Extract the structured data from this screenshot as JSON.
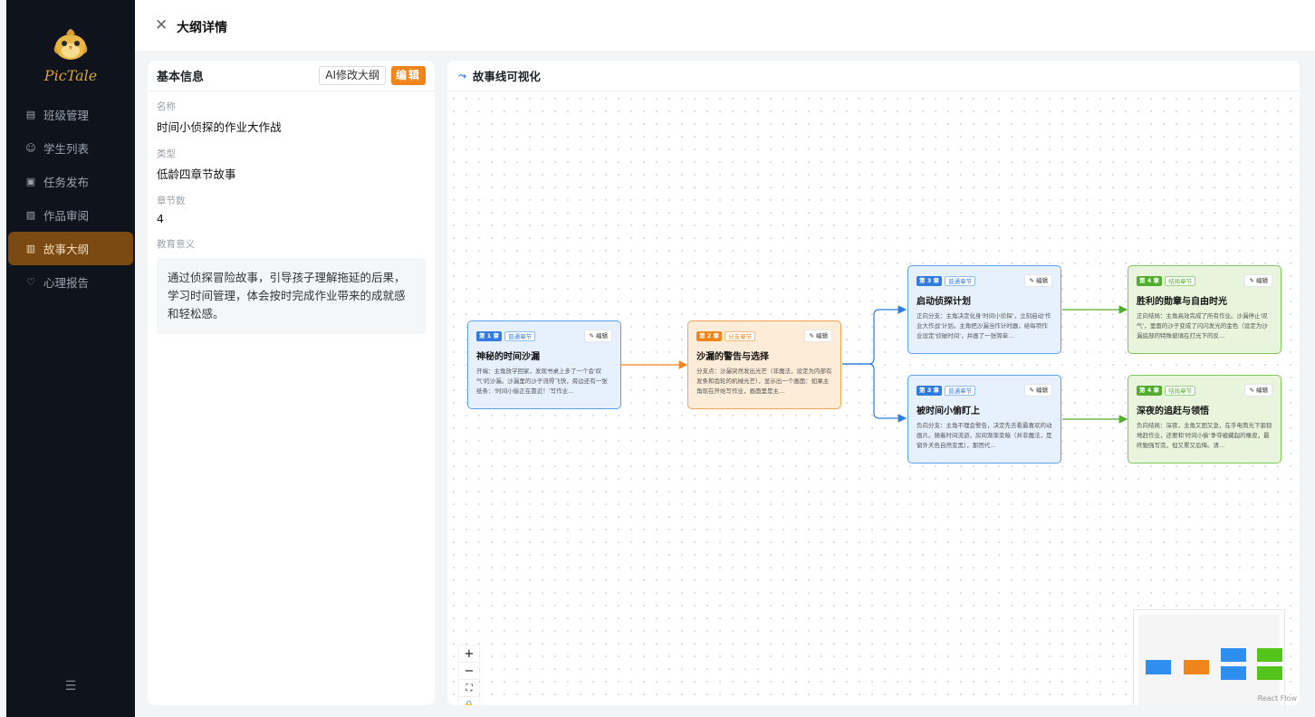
{
  "app": {
    "logo_text": "PicTale"
  },
  "sidebar": {
    "items": [
      {
        "label": "班级管理",
        "icon": "class-icon"
      },
      {
        "label": "学生列表",
        "icon": "student-icon"
      },
      {
        "label": "任务发布",
        "icon": "task-icon"
      },
      {
        "label": "作品审阅",
        "icon": "review-icon"
      },
      {
        "label": "故事大纲",
        "icon": "outline-icon",
        "active": true
      },
      {
        "label": "心理报告",
        "icon": "heart-icon"
      }
    ]
  },
  "header": {
    "title": "大纲详情"
  },
  "info": {
    "title": "基本信息",
    "ai_button": "AI修改大纲",
    "edit_button": "编辑",
    "name_label": "名称",
    "name_value": "时间小侦探的作业大作战",
    "type_label": "类型",
    "type_value": "低龄四章节故事",
    "chapters_label": "章节数",
    "chapters_value": "4",
    "edu_label": "教育意义",
    "edu_value": "通过侦探冒险故事，引导孩子理解拖延的后果，学习时间管理，体会按时完成作业带来的成就感和轻松感。"
  },
  "flow": {
    "title": "故事线可视化",
    "watermark": "React Flow",
    "edit_label": "编辑",
    "nodes": [
      {
        "chapter": "第 1 章",
        "type": "普通章节",
        "title": "神秘的时间沙漏",
        "desc": "开端：主角放学回家，发现书桌上多了一个会'叹气'的沙漏。沙漏里的沙子流得飞快，旁边还有一张纸条：'时间小偷正在靠近！'写作业...",
        "color": "blue"
      },
      {
        "chapter": "第 2 章",
        "type": "分支章节",
        "title": "沙漏的警告与选择",
        "desc": "分支点：沙漏突然发出光芒（非魔法，设定为内部有发条和齿轮的机械光芒），显示出一个画面：如果主角现在开始写作业，画面里是主...",
        "color": "orange"
      },
      {
        "chapter": "第 3 章",
        "type": "普通章节",
        "title": "启动侦探计划",
        "desc": "正向分支：主角决定化身'时间小侦探'，立刻启动'作业大作战'计划。主角把沙漏当作计时器，给每项作业设定'侦破时间'，并画了一张简单...",
        "color": "blue"
      },
      {
        "chapter": "第 3 章",
        "type": "普通章节",
        "title": "被时间小偷盯上",
        "desc": "负向分支：主角不理会警告，决定先去看最喜欢的动画片。随着时间流逝，房间渐渐变暗（并非魔法，是窗外天色自然变黑），那团代...",
        "color": "blue"
      },
      {
        "chapter": "第 4 章",
        "type": "结局章节",
        "title": "胜利的勋章与自由时光",
        "desc": "正向结局：主角高效完成了所有作业。沙漏停止'叹气'，里面的沙子变成了闪闪发光的金色（设定为沙漏底部的特殊玻璃在灯光下的反...",
        "color": "green"
      },
      {
        "chapter": "第 4 章",
        "type": "结局章节",
        "title": "深夜的追赶与领悟",
        "desc": "负向结局：深夜，主角又困又急，在手电筒光下狼狈地赶作业，还要和'时间小偷'争夺被藏起的橡皮，最终勉强写完，但又累又后悔。清...",
        "color": "green"
      }
    ],
    "colors": {
      "blue_edge": "#2f7be0",
      "orange_edge": "#f0861b",
      "green_edge": "#52ad2e"
    }
  }
}
